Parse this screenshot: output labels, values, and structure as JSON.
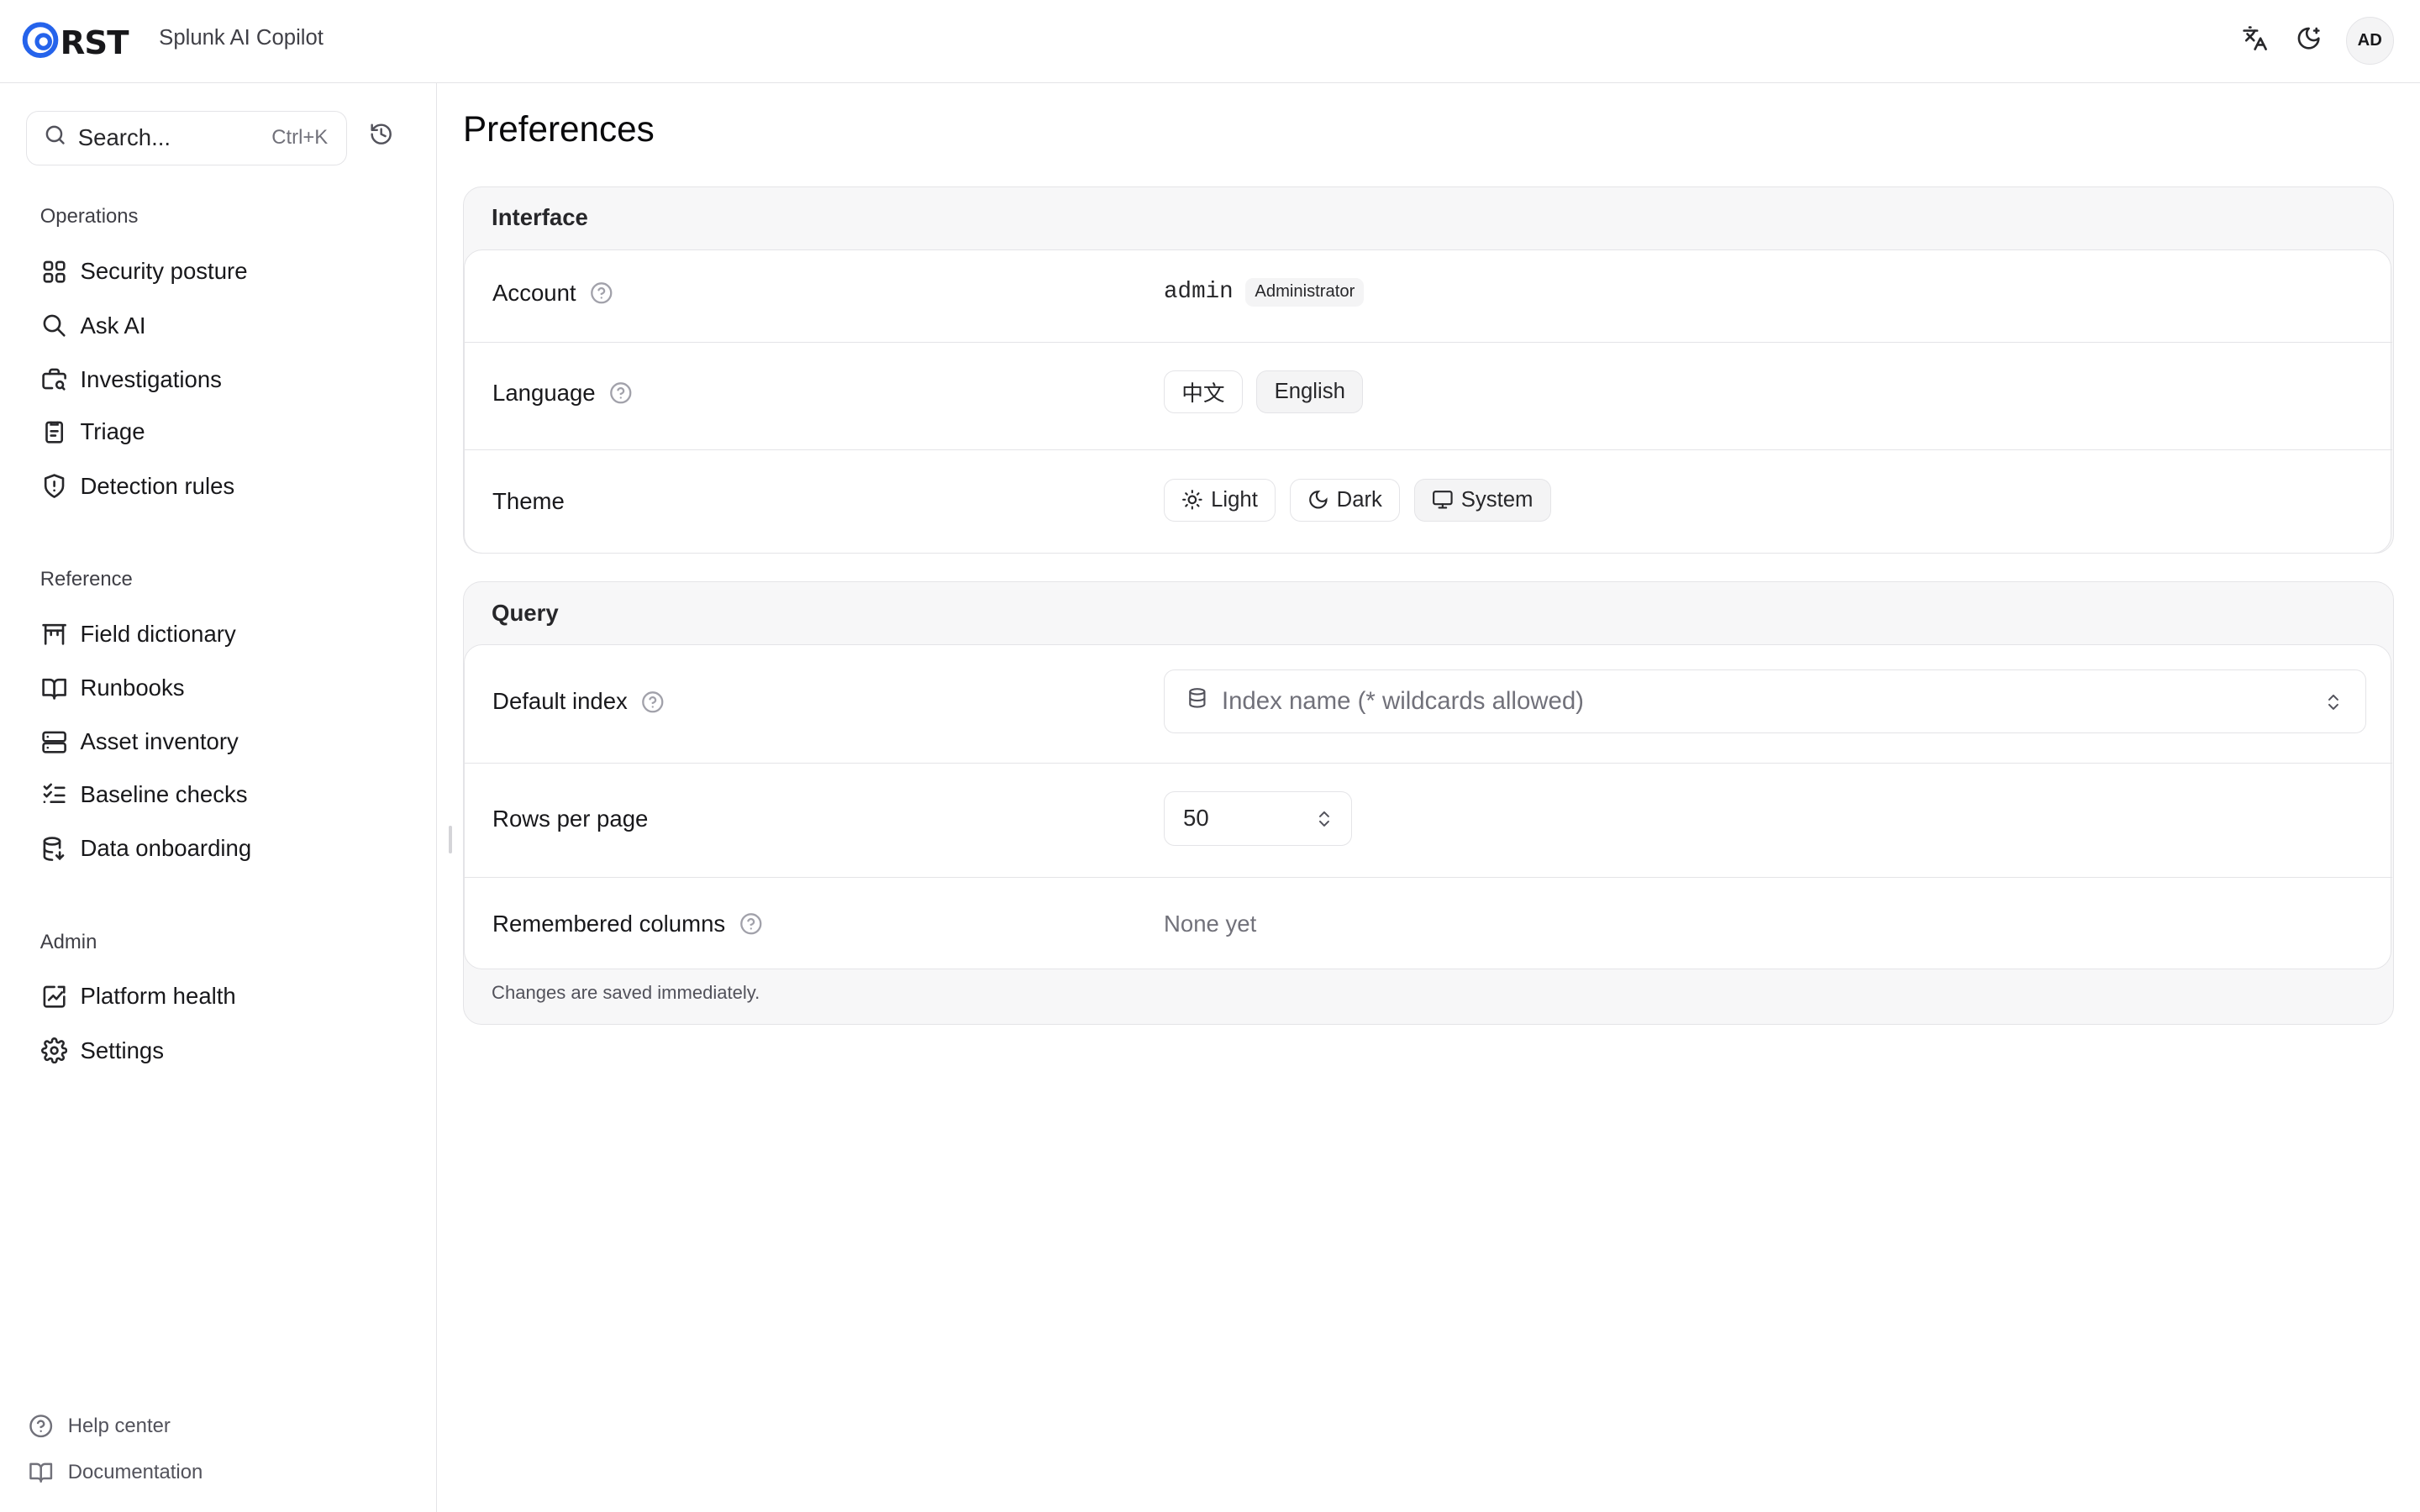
{
  "header": {
    "logo_text": "RST",
    "app_name": "Splunk AI Copilot",
    "avatar_initials": "AD"
  },
  "sidebar": {
    "search_label": "Search...",
    "search_shortcut": "Ctrl+K",
    "sections": [
      {
        "title": "Operations",
        "items": [
          {
            "label": "Security posture",
            "icon": "grid-icon"
          },
          {
            "label": "Ask AI",
            "icon": "search-icon"
          },
          {
            "label": "Investigations",
            "icon": "briefcase-search-icon"
          },
          {
            "label": "Triage",
            "icon": "clipboard-list-icon"
          },
          {
            "label": "Detection rules",
            "icon": "shield-alert-icon"
          }
        ]
      },
      {
        "title": "Reference",
        "items": [
          {
            "label": "Field dictionary",
            "icon": "gate-icon"
          },
          {
            "label": "Runbooks",
            "icon": "book-open-icon"
          },
          {
            "label": "Asset inventory",
            "icon": "server-icon"
          },
          {
            "label": "Baseline checks",
            "icon": "list-checks-icon"
          },
          {
            "label": "Data onboarding",
            "icon": "database-import-icon"
          }
        ]
      },
      {
        "title": "Admin",
        "items": [
          {
            "label": "Platform health",
            "icon": "activity-chart-icon"
          },
          {
            "label": "Settings",
            "icon": "gear-icon"
          }
        ]
      }
    ],
    "footer": [
      {
        "label": "Help center",
        "icon": "help-circle-icon"
      },
      {
        "label": "Documentation",
        "icon": "book-icon"
      }
    ]
  },
  "page": {
    "title": "Preferences"
  },
  "interface": {
    "title": "Interface",
    "account": {
      "label": "Account",
      "username": "admin",
      "role": "Administrator"
    },
    "language": {
      "label": "Language",
      "options": [
        "中文",
        "English"
      ],
      "selected": "English"
    },
    "theme": {
      "label": "Theme",
      "options": [
        "Light",
        "Dark",
        "System"
      ],
      "selected": "System"
    }
  },
  "query": {
    "title": "Query",
    "default_index": {
      "label": "Default index",
      "placeholder": "Index name (* wildcards allowed)"
    },
    "rows_per_page": {
      "label": "Rows per page",
      "value": "50"
    },
    "remembered_columns": {
      "label": "Remembered columns",
      "value": "None yet"
    },
    "footnote": "Changes are saved immediately."
  },
  "colors": {
    "logo_accent": "#2563eb",
    "border": "#e4e4e7",
    "card_bg": "#f7f7f8",
    "muted_text": "#71717a"
  }
}
